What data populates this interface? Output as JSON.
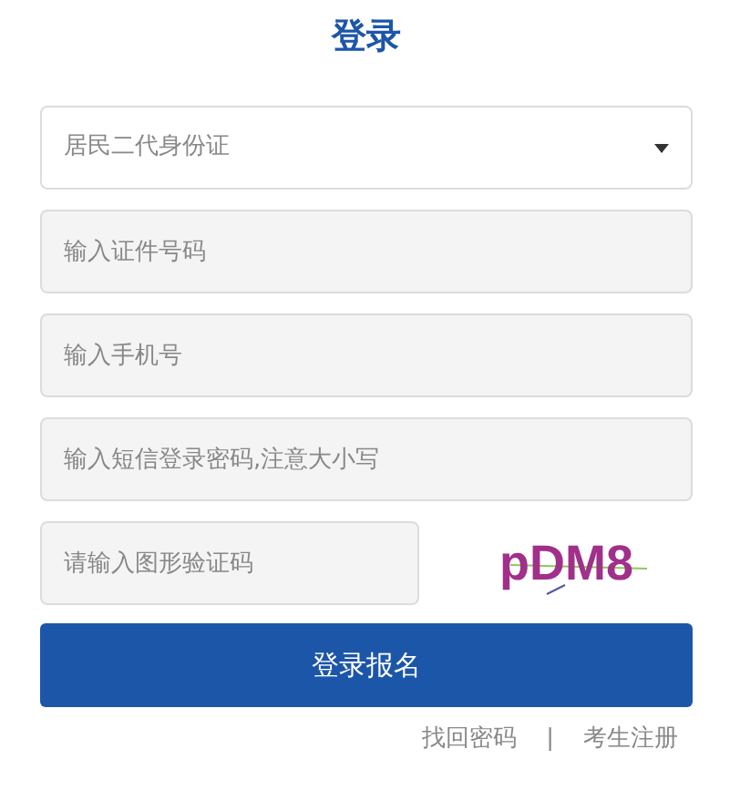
{
  "title": "登录",
  "fields": [
    {
      "kind": "select",
      "value": "居民二代身份证"
    },
    {
      "kind": "input",
      "placeholder": "输入证件号码"
    },
    {
      "kind": "input",
      "placeholder": "输入手机号"
    },
    {
      "kind": "input",
      "placeholder": "输入短信登录密码,注意大小写"
    }
  ],
  "captcha": {
    "placeholder": "请输入图形验证码",
    "code": "pDM8"
  },
  "submit": "登录报名",
  "links": [
    {
      "label": "找回密码"
    },
    {
      "label": "考生注册"
    }
  ],
  "separator": "|"
}
